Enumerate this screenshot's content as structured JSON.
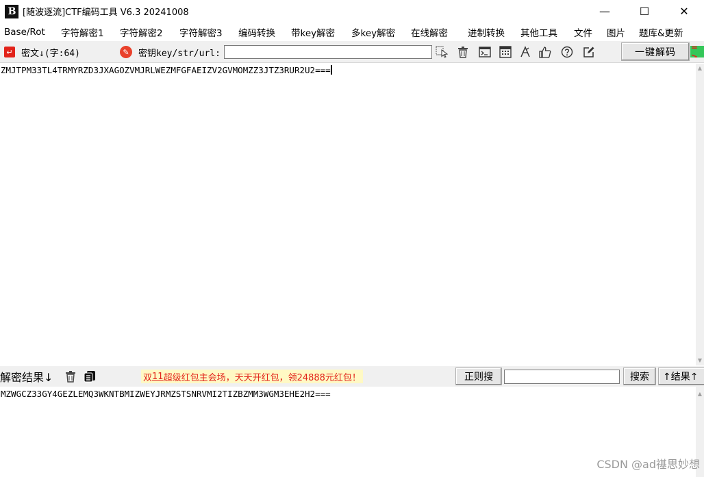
{
  "window": {
    "logo_text": "B",
    "title": "[随波逐流]CTF编码工具 V6.3 20241008",
    "minimize": "—",
    "maximize": "☐",
    "close": "✕"
  },
  "menu": [
    {
      "label": "Base/Rot"
    },
    {
      "label": "字符解密1"
    },
    {
      "label": "字符解密2"
    },
    {
      "label": "字符解密3"
    },
    {
      "label": "编码转换"
    },
    {
      "label": "带key解密"
    },
    {
      "label": "多key解密"
    },
    {
      "label": "在线解密"
    },
    {
      "label": "进制转换"
    },
    {
      "label": "其他工具"
    },
    {
      "label": "文件"
    },
    {
      "label": "图片"
    },
    {
      "label": "题库&更新"
    }
  ],
  "toolbar": {
    "cipher_label": "密文↓(字:64)",
    "key_label": "密钥key/str/url:",
    "key_value": "",
    "decode_button": "一键解码",
    "side_tag": "= >"
  },
  "cipher": {
    "text": "ZMJTPM33TL4TRMYRZD3JXAGOZVMJRLWEZMFGFAEIZV2GVMOMZZ3JTZ3RUR2U2==="
  },
  "result_bar": {
    "label": "解密结果↓",
    "promo_prefix": "双",
    "promo_underlined": "11",
    "promo_rest": "超级红包主会场，天天开红包，领24888元红包！",
    "regex_button": "正则搜",
    "search_value": "",
    "search_button": "搜索",
    "result_up_button": "↑结果↑"
  },
  "result": {
    "text": "MZWGCZ33GY4GEZLEMQ3WKNTBMIZWEYJRMZSTSNRVMI2TIZBZMM3WGM3EHE2H2==="
  },
  "watermark": "CSDN @ad禥思妙想"
}
